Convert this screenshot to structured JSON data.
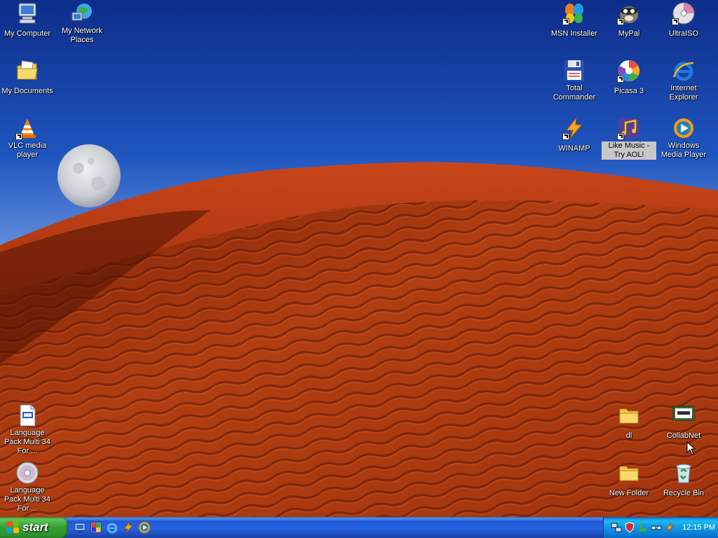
{
  "desktop": {
    "icons_left": [
      {
        "label": "My Computer",
        "icon": "my-computer-icon"
      },
      {
        "label": "My Network Places",
        "icon": "network-places-icon"
      },
      {
        "label": "My Documents",
        "icon": "my-documents-icon"
      },
      {
        "label": "VLC media player",
        "icon": "vlc-icon"
      },
      {
        "label": "Language Pack Multi 34 For ...",
        "icon": "language-pack-document-icon"
      },
      {
        "label": "Language Pack Multi 34 For ...",
        "icon": "language-pack-disc-icon"
      }
    ],
    "icons_right": [
      {
        "label": "MSN Installer",
        "icon": "msn-butterfly-icon"
      },
      {
        "label": "MyPal",
        "icon": "mypal-icon"
      },
      {
        "label": "UltraISO",
        "icon": "ultraiso-disc-icon"
      },
      {
        "label": "Total Commander",
        "icon": "floppy-disk-icon"
      },
      {
        "label": "Picasa 3",
        "icon": "picasa-icon"
      },
      {
        "label": "Internet Explorer",
        "icon": "internet-explorer-icon"
      },
      {
        "label": "WINAMP",
        "icon": "winamp-icon"
      },
      {
        "label": "Like Music - Try AOL!",
        "icon": "like-music-icon"
      },
      {
        "label": "Windows Media Player",
        "icon": "windows-media-player-icon"
      },
      {
        "label": "dl",
        "icon": "folder-icon"
      },
      {
        "label": "CollabNet",
        "icon": "collabnet-icon"
      },
      {
        "label": "New Folder",
        "icon": "folder-icon"
      },
      {
        "label": "Recycle Bin",
        "icon": "recycle-bin-icon"
      }
    ],
    "selected_icon": "Like Music - Try AOL!"
  },
  "taskbar": {
    "start_label": "start",
    "quick_launch": [
      "show-desktop-icon",
      "paint-icon",
      "internet-explorer-icon",
      "winamp-icon",
      "windows-media-player-icon"
    ],
    "tray_icons": [
      "network-icon",
      "shield-icon",
      "messenger-icon",
      "network-activity-icon",
      "winamp-icon"
    ],
    "clock": "12:15 PM"
  },
  "colors": {
    "sky_top": "#0d2d8a",
    "dune_red": "#b8360e",
    "taskbar_blue": "#2663e0",
    "start_green": "#36a336",
    "tray_blue": "#0e8ee0"
  }
}
